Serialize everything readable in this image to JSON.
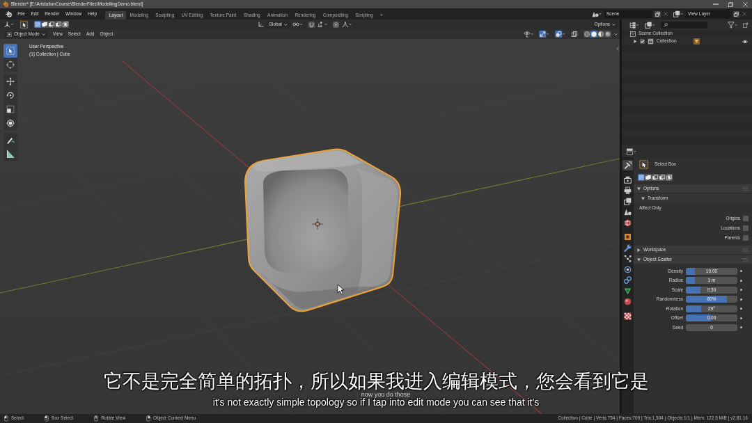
{
  "window": {
    "title": "Blender* [E:\\ArtstationCourse\\BlenderFiles\\ModellingDemo.blend]"
  },
  "menu": [
    "File",
    "Edit",
    "Render",
    "Window",
    "Help"
  ],
  "workspace_tabs": [
    {
      "label": "Layout",
      "selected": true
    },
    {
      "label": "Modeling",
      "selected": false
    },
    {
      "label": "Sculpting",
      "selected": false
    },
    {
      "label": "UV Editing",
      "selected": false
    },
    {
      "label": "Texture Paint",
      "selected": false
    },
    {
      "label": "Shading",
      "selected": false
    },
    {
      "label": "Animation",
      "selected": false
    },
    {
      "label": "Rendering",
      "selected": false
    },
    {
      "label": "Compositing",
      "selected": false
    },
    {
      "label": "Scripting",
      "selected": false
    }
  ],
  "add_tab": "+",
  "scene": {
    "value": "Scene"
  },
  "view_layer": {
    "value": "View Layer"
  },
  "tool_settings": {
    "select_modes": [
      {
        "kind": "set",
        "selected": true
      },
      {
        "kind": "extend",
        "selected": false
      },
      {
        "kind": "subtract",
        "selected": false
      },
      {
        "kind": "difference",
        "selected": false
      },
      {
        "kind": "intersect",
        "selected": false
      }
    ],
    "orientation": "Global",
    "snapping": {
      "on": false
    },
    "proportional_editing": {
      "on": false
    },
    "options": "Options"
  },
  "viewport_header": {
    "mode": "Object Mode",
    "menus": [
      "View",
      "Select",
      "Add",
      "Object"
    ],
    "toggles": [
      {
        "kind": "gizmos",
        "on": true
      },
      {
        "kind": "overlays",
        "on": true
      },
      {
        "kind": "xray",
        "on": false
      }
    ],
    "shading": [
      {
        "kind": "wireframe",
        "selected": false
      },
      {
        "kind": "solid",
        "selected": true
      },
      {
        "kind": "material",
        "selected": false
      },
      {
        "kind": "rendered",
        "selected": false
      }
    ]
  },
  "toolbar_groups": [
    {
      "tools": [
        {
          "kind": "select",
          "selected": true
        },
        {
          "kind": "cursor",
          "selected": false
        }
      ]
    },
    {
      "tools": [
        {
          "kind": "move",
          "selected": false
        },
        {
          "kind": "rotate",
          "selected": false
        },
        {
          "kind": "scale",
          "selected": false
        },
        {
          "kind": "transform",
          "selected": false
        }
      ]
    },
    {
      "tools": [
        {
          "kind": "annotate",
          "selected": false
        },
        {
          "kind": "measure",
          "selected": false
        }
      ]
    }
  ],
  "viewport": {
    "view_name": "User Perspective",
    "object_info": "(1) Collection | Cube"
  },
  "subtitles": {
    "chinese": "它不是完全简单的拓扑，所以如果我进入编辑模式，您会看到它是",
    "background_caption": "now you do those",
    "english": "it's not exactly simple topology so if I tap into edit mode you can see that it's"
  },
  "outliner": {
    "root": "Scene Collection",
    "items": [
      {
        "label": "Collection",
        "expanded": false,
        "checked": true,
        "visible": true
      }
    ]
  },
  "properties": {
    "tab_groups": [
      {
        "tabs": [
          {
            "kind": "tool",
            "selected": true
          }
        ]
      },
      {
        "tabs": [
          {
            "kind": "render",
            "selected": false
          },
          {
            "kind": "output",
            "selected": false
          },
          {
            "kind": "view_layer",
            "selected": false
          },
          {
            "kind": "scene",
            "selected": false
          },
          {
            "kind": "world",
            "selected": false
          }
        ]
      },
      {
        "tabs": [
          {
            "kind": "object",
            "selected": false
          },
          {
            "kind": "modifiers",
            "selected": false
          },
          {
            "kind": "particles",
            "selected": false
          },
          {
            "kind": "physics",
            "selected": false
          },
          {
            "kind": "constraints",
            "selected": false
          },
          {
            "kind": "data",
            "selected": false
          },
          {
            "kind": "material",
            "selected": false
          }
        ]
      },
      {
        "tabs": [
          {
            "kind": "texture",
            "selected": false
          }
        ]
      }
    ],
    "tool": "Select Box",
    "select_modes": [
      {
        "kind": "set",
        "selected": true
      },
      {
        "kind": "extend",
        "selected": false
      },
      {
        "kind": "subtract",
        "selected": false
      },
      {
        "kind": "difference",
        "selected": false
      },
      {
        "kind": "intersect",
        "selected": false
      }
    ],
    "panels": [
      {
        "label": "Options",
        "expanded": true,
        "subpanel": {
          "label": "Transform",
          "expanded": true,
          "group_label": "Affect Only",
          "checkboxes": [
            {
              "label": "Origins",
              "checked": false
            },
            {
              "label": "Locations",
              "checked": false
            },
            {
              "label": "Parents",
              "checked": false
            }
          ]
        }
      },
      {
        "label": "Workspace",
        "expanded": false
      },
      {
        "label": "Object Scatter",
        "expanded": true,
        "fields": [
          {
            "kind": "slider",
            "label": "Density",
            "value": "10.00",
            "level": 0.17
          },
          {
            "kind": "slider",
            "label": "Radius",
            "value": "1 m",
            "level": 0.17
          },
          {
            "kind": "slider",
            "label": "Scale",
            "value": "0.30",
            "level": 0.28
          },
          {
            "kind": "slider",
            "label": "Randomness",
            "value": "80%",
            "level": 0.8
          },
          {
            "kind": "slider",
            "label": "Rotation",
            "value": "29°",
            "level": 0.3
          },
          {
            "kind": "slider",
            "label": "Offset",
            "value": "0.00",
            "level": 0.49
          },
          {
            "kind": "number",
            "label": "Seed",
            "value": "0"
          }
        ]
      }
    ]
  },
  "status_bar": {
    "hints": [
      {
        "kind": "left_click",
        "label": "Select"
      },
      {
        "kind": "left_drag",
        "label": "Box Select"
      },
      {
        "kind": "middle_click",
        "label": "Rotate View"
      },
      {
        "kind": "right_click",
        "label": "Object Context Menu"
      }
    ],
    "stats": "Collection | Cube | Verts:754 | Faces:709 | Tris:1,504 | Objects:1/1 | Mem: 122.5 MiB | v2.81.16"
  }
}
